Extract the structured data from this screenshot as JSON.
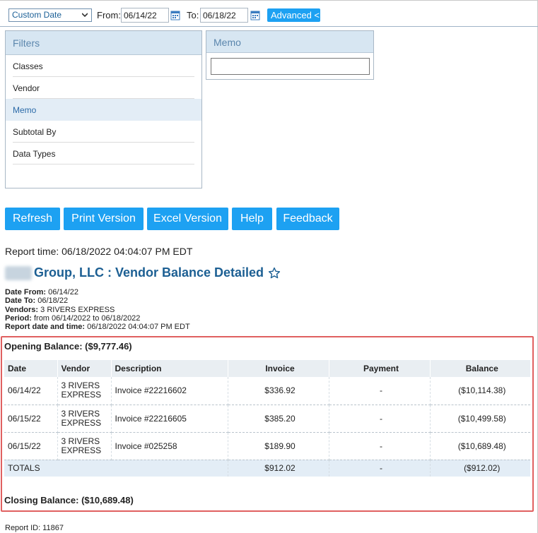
{
  "toolbar": {
    "range_select": "Custom Date",
    "from_label": "From:",
    "from_value": "06/14/22",
    "to_label": "To:",
    "to_value": "06/18/22",
    "advanced_label": "Advanced <"
  },
  "filters": {
    "title": "Filters",
    "items": [
      "Classes",
      "Vendor",
      "Memo",
      "Subtotal By",
      "Data Types"
    ],
    "active": "Memo"
  },
  "memo": {
    "title": "Memo",
    "value": ""
  },
  "actions": {
    "refresh": "Refresh",
    "print": "Print Version",
    "excel": "Excel Version",
    "help": "Help",
    "feedback": "Feedback"
  },
  "report": {
    "time": "Report time: 06/18/2022 04:04:07 PM EDT",
    "title": "Group, LLC : Vendor Balance Detailed",
    "meta": {
      "date_from_label": "Date From:",
      "date_from": "06/14/22",
      "date_to_label": "Date To:",
      "date_to": "06/18/22",
      "vendors_label": "Vendors:",
      "vendors": "3 RIVERS EXPRESS",
      "period_label": "Period:",
      "period": "from 06/14/2022 to 06/18/2022",
      "datetime_label": "Report date and time:",
      "datetime": "06/18/2022 04:04:07 PM EDT"
    },
    "opening": "Opening Balance: ($9,777.46)",
    "columns": [
      "Date",
      "Vendor",
      "Description",
      "Invoice",
      "Payment",
      "Balance"
    ],
    "rows": [
      {
        "date": "06/14/22",
        "vendor1": "3 RIVERS",
        "vendor2": "EXPRESS",
        "description": "Invoice #22216602",
        "invoice": "$336.92",
        "payment": "-",
        "balance": "($10,114.38)"
      },
      {
        "date": "06/15/22",
        "vendor1": "3 RIVERS",
        "vendor2": "EXPRESS",
        "description": "Invoice #22216605",
        "invoice": "$385.20",
        "payment": "-",
        "balance": "($10,499.58)"
      },
      {
        "date": "06/15/22",
        "vendor1": "3 RIVERS",
        "vendor2": "EXPRESS",
        "description": "Invoice #025258",
        "invoice": "$189.90",
        "payment": "-",
        "balance": "($10,689.48)"
      }
    ],
    "totals": {
      "label": "TOTALS",
      "invoice": "$912.02",
      "payment": "-",
      "balance": "($912.02)"
    },
    "closing": "Closing Balance: ($10,689.48)",
    "report_id": "Report ID: 11867"
  },
  "colors": {
    "accent": "#1da1f2",
    "title": "#1c5f93",
    "highlight_border": "#e06060"
  }
}
